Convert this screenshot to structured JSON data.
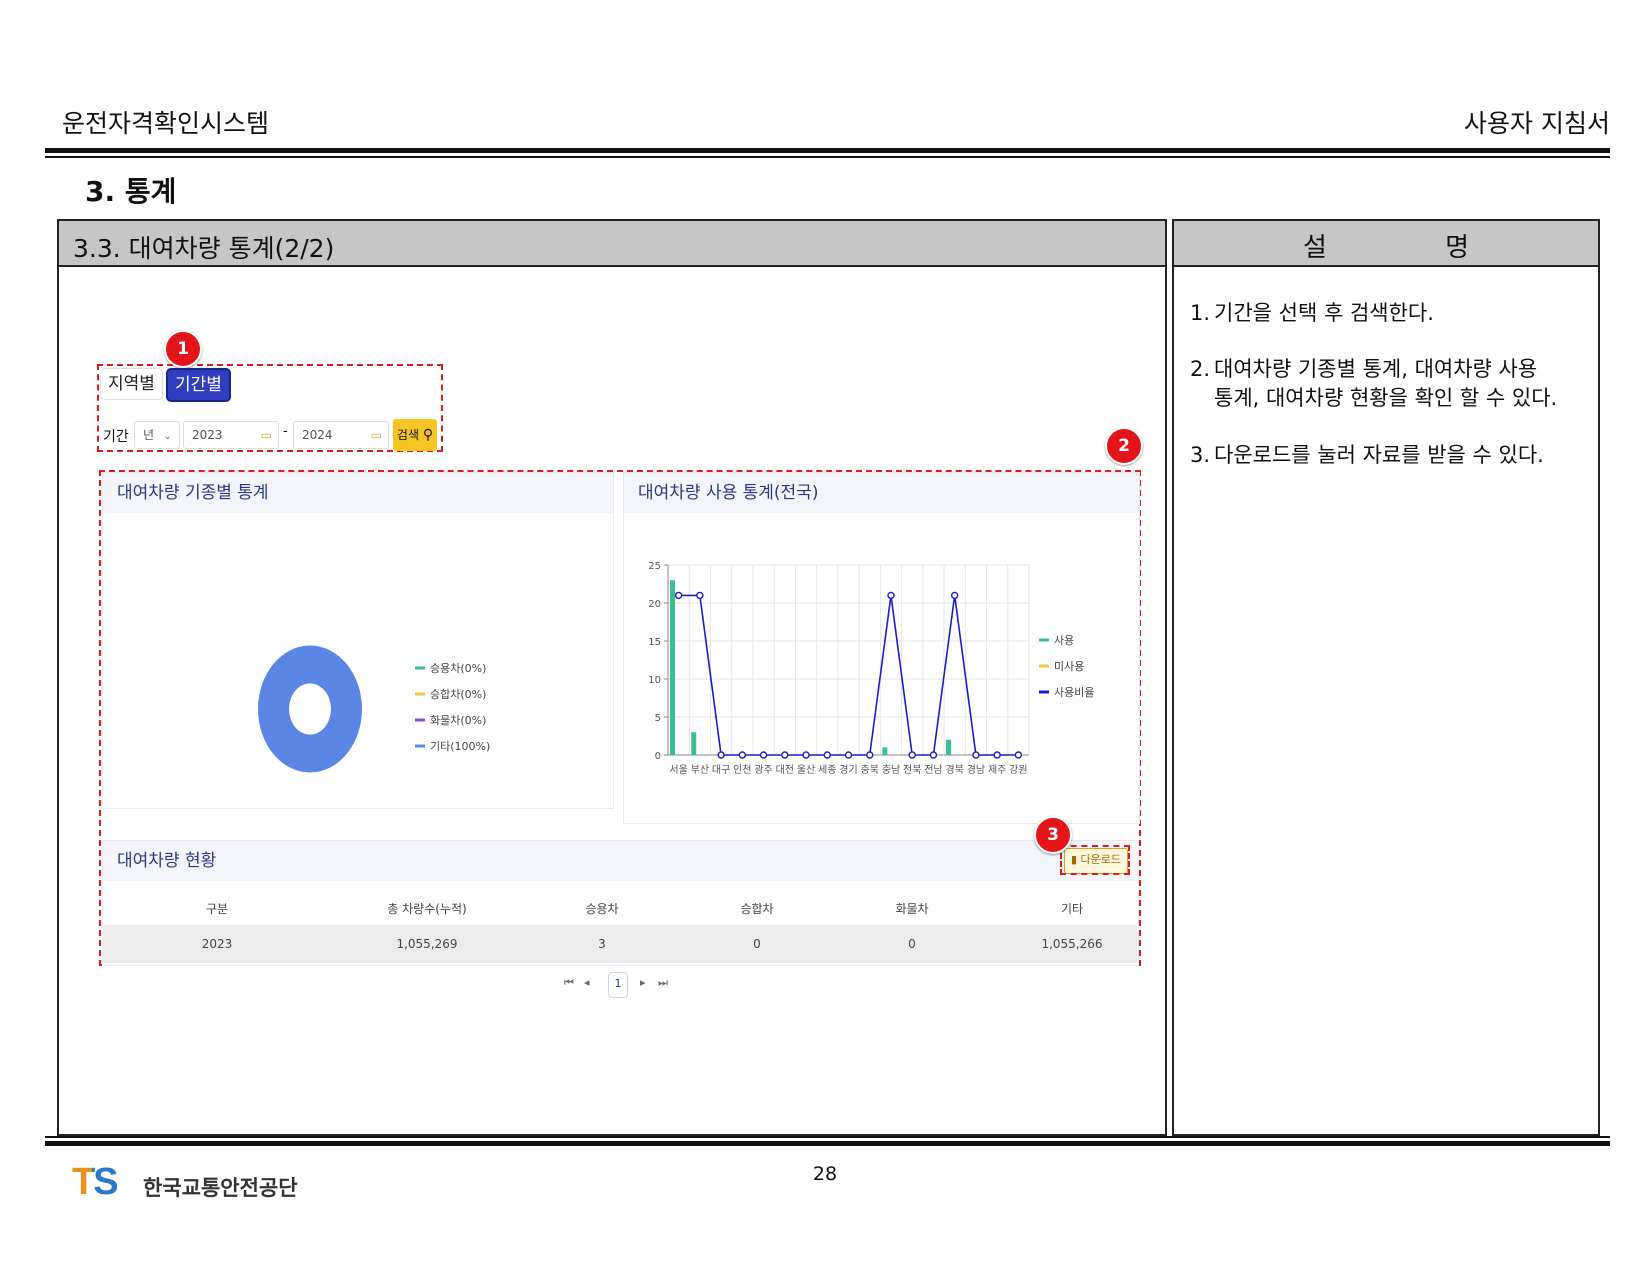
{
  "header": {
    "system_name": "운전자격확인시스템",
    "doc_type": "사용자 지침서"
  },
  "section": {
    "title": "3. 통계"
  },
  "left_panel": {
    "title": "3.3. 대여차량 통계(2/2)"
  },
  "right_panel": {
    "title": "설 명",
    "items": [
      {
        "num": "1.",
        "text": "기간을 선택 후 검색한다."
      },
      {
        "num": "2.",
        "text": "대여차량 기종별 통계, 대여차량 사용",
        "cont": "통계, 대여차량 현황을 확인 할 수 있다."
      },
      {
        "num": "3.",
        "text": "다운로드를 눌러 자료를 받을 수 있다."
      }
    ]
  },
  "badges": [
    "1",
    "2",
    "3"
  ],
  "screen": {
    "tabs": {
      "region": "지역별",
      "period": "기간별"
    },
    "period_label": "기간",
    "unit_select": "년",
    "from_year": "2023",
    "to_year": "2024",
    "dash": "-",
    "search_label": "검색",
    "cards": {
      "type_stats": "대여차량 기종별 통계",
      "usage_stats": "대여차량 사용 통계(전국)",
      "status": "대여차량 현황"
    },
    "download_label": "다운로드",
    "table": {
      "headers": [
        "구분",
        "총 차량수(누적)",
        "승용차",
        "승합차",
        "화물차",
        "기타"
      ],
      "rows": [
        [
          "2023",
          "1,055,269",
          "3",
          "0",
          "0",
          "1,055,266"
        ]
      ]
    },
    "pagination": {
      "first": "⏮",
      "prev": "◂",
      "current": "1",
      "next": "▸",
      "last": "⏭"
    }
  },
  "chart_data": [
    {
      "type": "pie",
      "donut": true,
      "categories": [
        "승용차(0%)",
        "승합차(0%)",
        "화물차(0%)",
        "기타(100%)"
      ],
      "values": [
        0,
        0,
        0,
        100
      ],
      "colors": [
        "#3bbf8f",
        "#f2c14e",
        "#8a4fd1",
        "#5b86e5"
      ],
      "legend_position": "right"
    },
    {
      "type": "bar",
      "categories": [
        "서울",
        "부산",
        "대구",
        "인천",
        "광주",
        "대전",
        "울산",
        "세종",
        "경기",
        "충북",
        "충남",
        "전북",
        "전남",
        "경북",
        "경남",
        "제주",
        "강원"
      ],
      "series": [
        {
          "name": "사용",
          "type": "bar",
          "color": "#3bbf8f",
          "values": [
            23,
            3,
            0,
            0,
            0,
            0,
            0,
            0,
            0,
            0,
            1,
            0,
            0,
            2,
            0,
            0,
            0
          ]
        },
        {
          "name": "미사용",
          "type": "bar",
          "color": "#f2c14e",
          "values": [
            0,
            0,
            0,
            0,
            0,
            0,
            0,
            0,
            0,
            0,
            0,
            0,
            0,
            0,
            0,
            0,
            0
          ]
        },
        {
          "name": "사용비율",
          "type": "line",
          "color": "#1c1ccc",
          "values": [
            21,
            21,
            0,
            0,
            0,
            0,
            0,
            0,
            0,
            0,
            21,
            0,
            0,
            21,
            0,
            0,
            0
          ]
        }
      ],
      "ylim": [
        0,
        25
      ],
      "yticks": [
        0,
        5,
        10,
        15,
        20,
        25
      ],
      "grid": true,
      "legend_position": "right"
    }
  ],
  "footer": {
    "page": "28",
    "logo": "TS",
    "org": "한국교통안전공단"
  }
}
